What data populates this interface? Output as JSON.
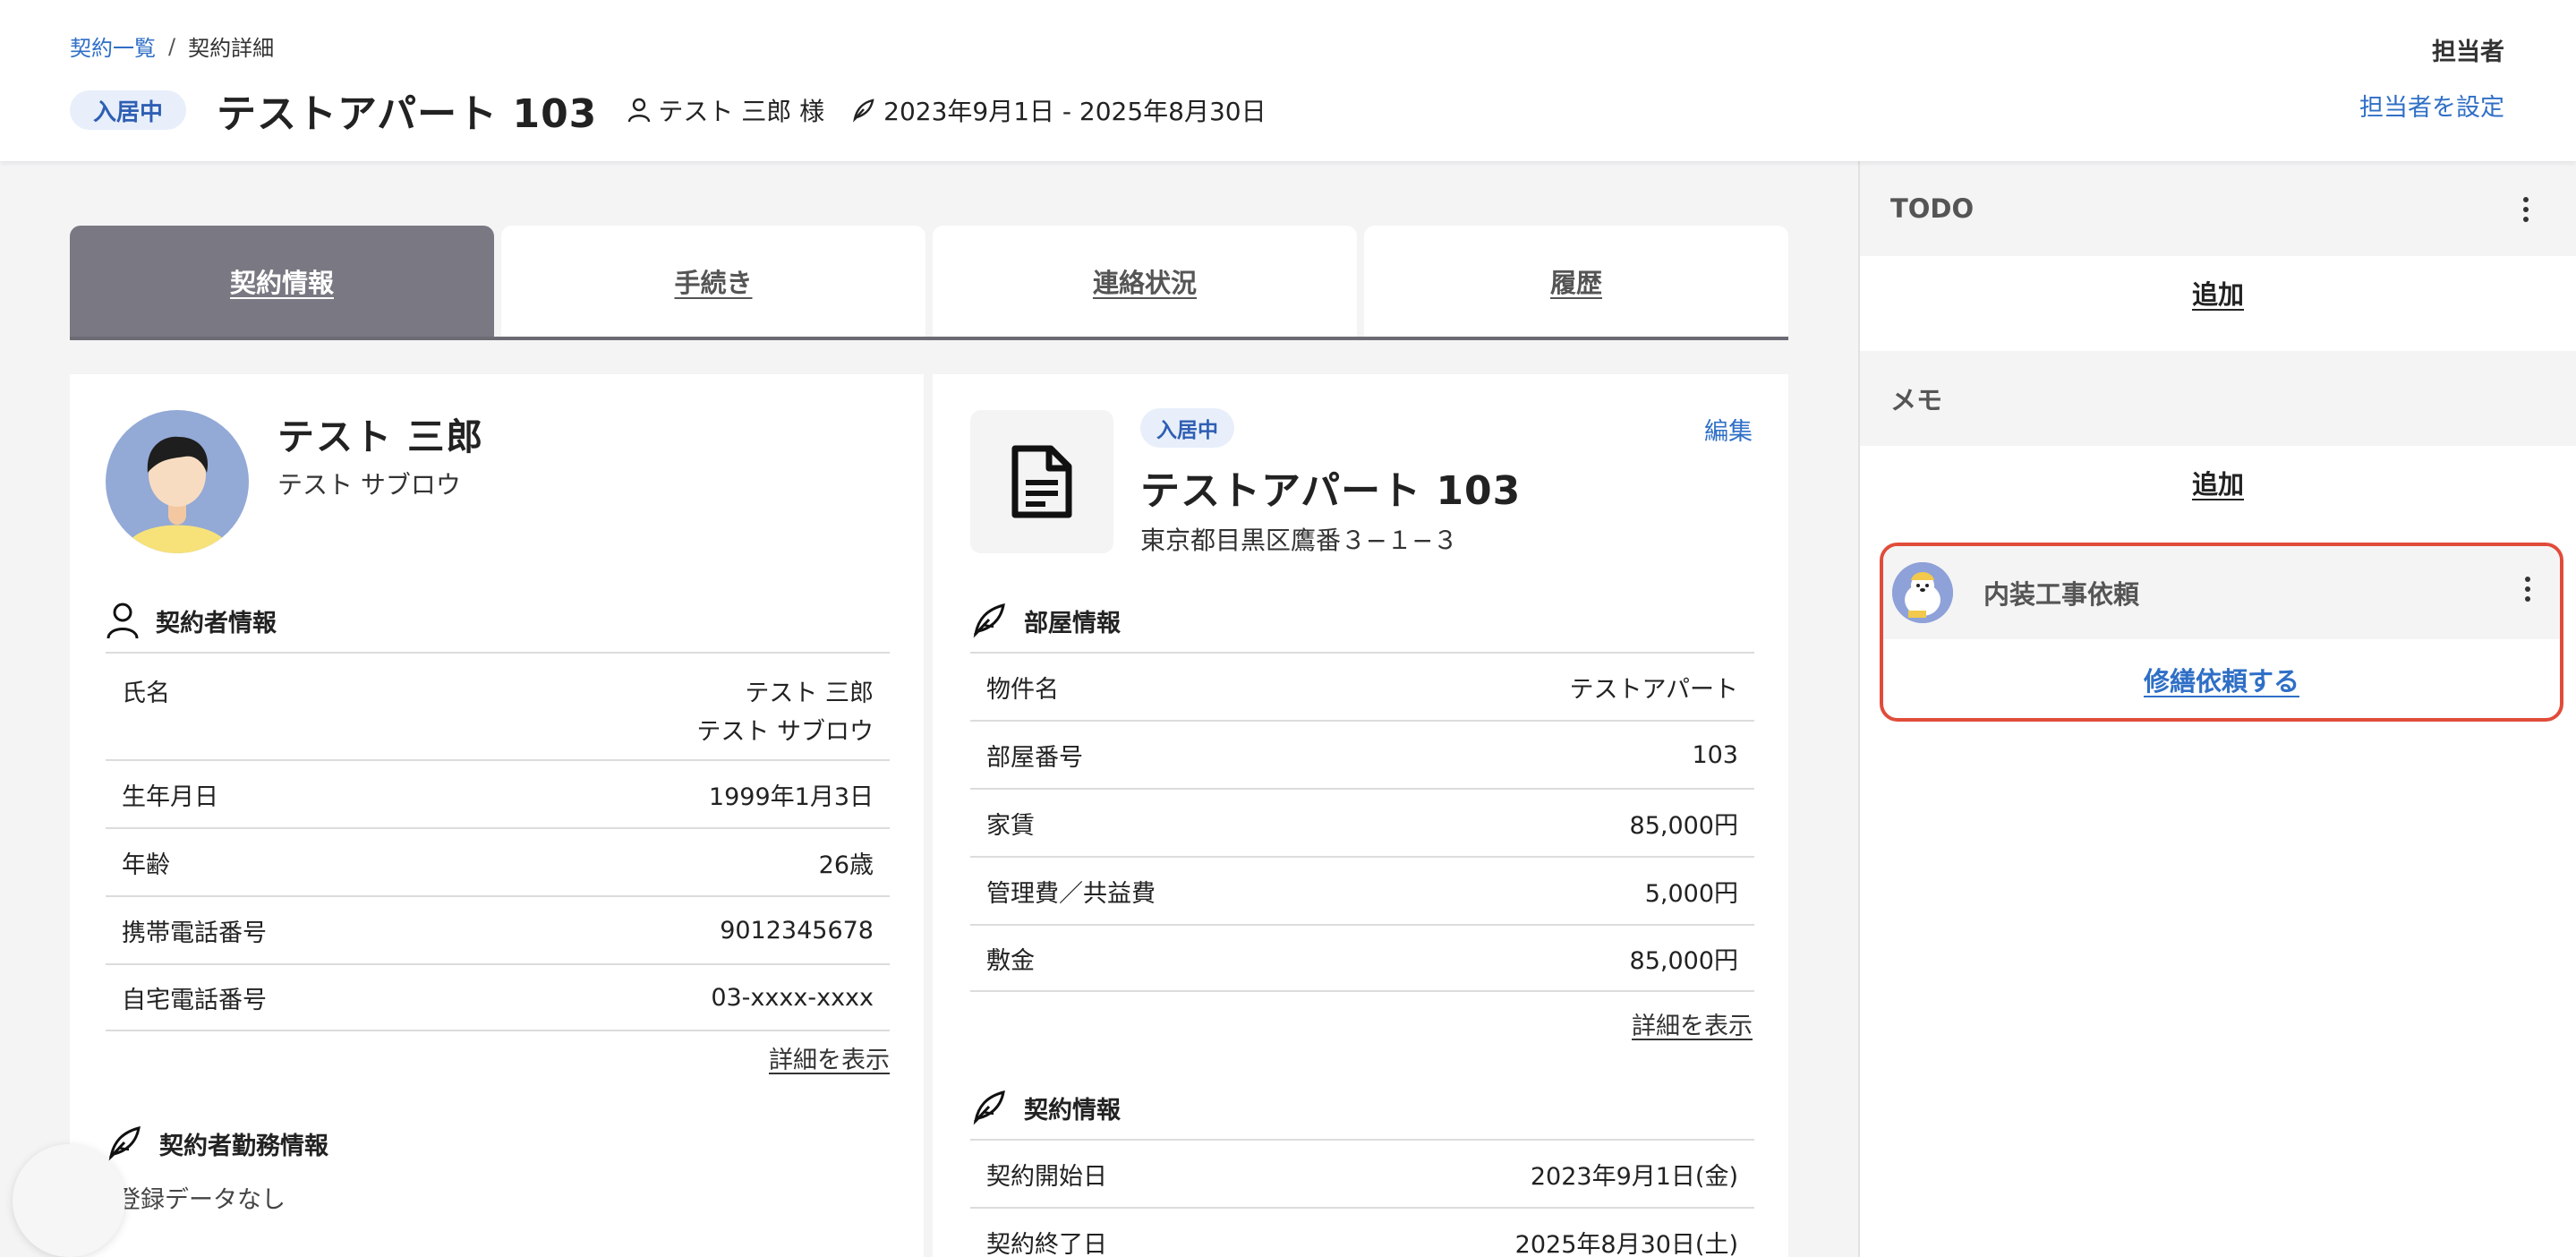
{
  "breadcrumb": {
    "list": "契約一覧",
    "separator": "/",
    "current": "契約詳細"
  },
  "header": {
    "status": "入居中",
    "title": "テストアパート 103",
    "tenant": "テスト 三郎 様",
    "period": "2023年9月1日 - 2025年8月30日",
    "assignee_label": "担当者",
    "assignee_link": "担当者を設定"
  },
  "tabs": [
    {
      "label": "契約情報",
      "active": true
    },
    {
      "label": "手続き",
      "active": false
    },
    {
      "label": "連絡状況",
      "active": false
    },
    {
      "label": "履歴",
      "active": false
    }
  ],
  "contractor": {
    "name": "テスト 三郎",
    "kana": "テスト サブロウ",
    "section_title": "契約者情報",
    "rows": [
      {
        "label": "氏名",
        "value": "テスト 三郎",
        "value2": "テスト サブロウ"
      },
      {
        "label": "生年月日",
        "value": "1999年1月3日"
      },
      {
        "label": "年齢",
        "value": "26歳"
      },
      {
        "label": "携帯電話番号",
        "value": "9012345678"
      },
      {
        "label": "自宅電話番号",
        "value": "03-xxxx-xxxx"
      }
    ],
    "detail_link": "詳細を表示",
    "work_title": "契約者勤務情報",
    "work_empty": "登録データなし"
  },
  "property": {
    "status": "入居中",
    "name": "テストアパート 103",
    "address": "東京都目黒区鷹番３−１−３",
    "edit": "編集",
    "room_title": "部屋情報",
    "room_rows": [
      {
        "label": "物件名",
        "value": "テストアパート"
      },
      {
        "label": "部屋番号",
        "value": "103"
      },
      {
        "label": "家賃",
        "value": "85,000円"
      },
      {
        "label": "管理費／共益費",
        "value": "5,000円"
      },
      {
        "label": "敷金",
        "value": "85,000円"
      }
    ],
    "detail_link": "詳細を表示",
    "contract_title": "契約情報",
    "contract_rows": [
      {
        "label": "契約開始日",
        "value": "2023年9月1日(金)"
      },
      {
        "label": "契約終了日",
        "value": "2025年8月30日(土)"
      }
    ]
  },
  "side": {
    "todo_title": "TODO",
    "todo_add": "追加",
    "memo_title": "メモ",
    "memo_add": "追加",
    "task_title": "内装工事依頼",
    "task_link": "修繕依頼する"
  },
  "colors": {
    "accent": "#2f6fc6",
    "active_tab": "#7a7882",
    "highlight": "#e14c3a",
    "badge_bg": "#e8effb"
  },
  "icons": [
    "person-icon",
    "contract-pen-icon",
    "document-icon",
    "kebab-menu-icon"
  ]
}
